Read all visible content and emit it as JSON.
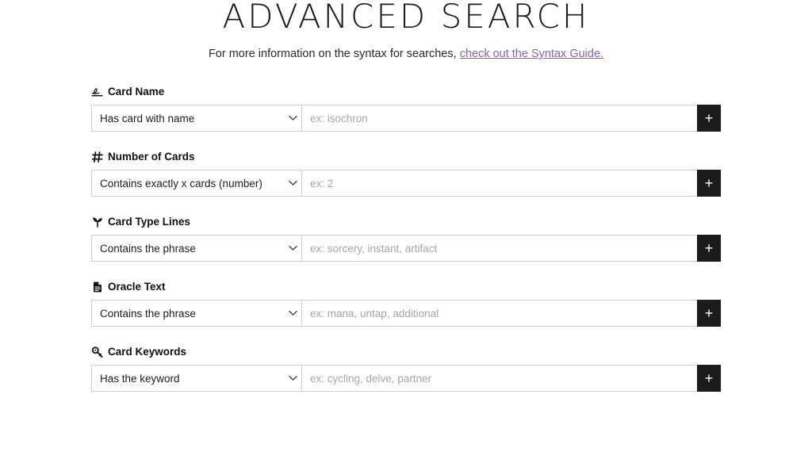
{
  "header": {
    "title": "ADVANCED SEARCH",
    "subtitle_prefix": "For more information on the syntax for searches,",
    "syntax_link": "check out the Syntax Guide.",
    "link_color": "#8a63b8"
  },
  "controls": {
    "add_button_label": "+",
    "chevron_icon": "chevron-down-icon"
  },
  "fields": [
    {
      "icon": "signature-icon",
      "label": "Card Name",
      "select_value": "Has card with name",
      "input_placeholder": "ex: isochron"
    },
    {
      "icon": "hash-icon",
      "label": "Number of Cards",
      "select_value": "Contains exactly x cards (number)",
      "input_placeholder": "ex: 2"
    },
    {
      "icon": "seedling-icon",
      "label": "Card Type Lines",
      "select_value": "Contains the phrase",
      "input_placeholder": "ex: sorcery, instant, artifact"
    },
    {
      "icon": "file-lines-icon",
      "label": "Oracle Text",
      "select_value": "Contains the phrase",
      "input_placeholder": "ex: mana, untap, additional"
    },
    {
      "icon": "key-icon",
      "label": "Card Keywords",
      "select_value": "Has the keyword",
      "input_placeholder": "ex: cycling, delve, partner"
    }
  ]
}
